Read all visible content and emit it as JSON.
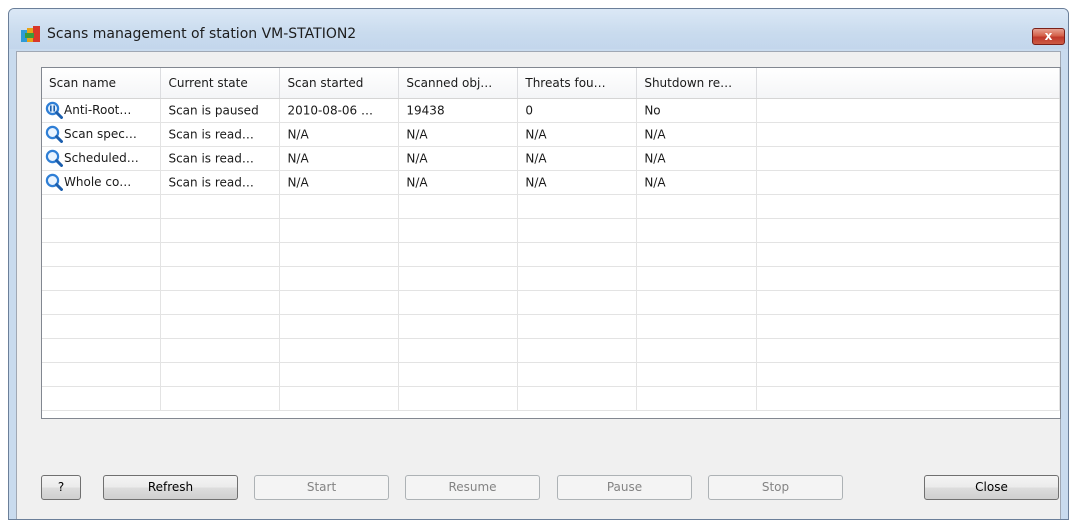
{
  "window": {
    "title": "Scans management of station VM-STATION2",
    "close_glyph": "x"
  },
  "table": {
    "columns": [
      "Scan name",
      "Current state",
      "Scan started",
      "Scanned obj…",
      "Threats fou…",
      "Shutdown re…"
    ],
    "rows": [
      {
        "icon": "paused-scan-icon",
        "cells": [
          "Anti-Root…",
          "Scan is paused",
          "2010-08-06 …",
          "19438",
          "0",
          "No"
        ]
      },
      {
        "icon": "magnifier-icon",
        "cells": [
          "Scan spec…",
          "Scan is read…",
          "N/A",
          "N/A",
          "N/A",
          "N/A"
        ]
      },
      {
        "icon": "magnifier-icon",
        "cells": [
          "Scheduled…",
          "Scan is read…",
          "N/A",
          "N/A",
          "N/A",
          "N/A"
        ]
      },
      {
        "icon": "magnifier-icon",
        "cells": [
          "Whole co…",
          "Scan is read…",
          "N/A",
          "N/A",
          "N/A",
          "N/A"
        ]
      }
    ]
  },
  "buttons": {
    "help": "?",
    "refresh": "Refresh",
    "start": "Start",
    "resume": "Resume",
    "pause": "Pause",
    "stop": "Stop",
    "close": "Close"
  },
  "colors": {
    "window_frame": "#c9dbee",
    "client_bg": "#f0f0f0",
    "icon_blue": "#2f7fd6",
    "close_red": "#c0392b"
  }
}
